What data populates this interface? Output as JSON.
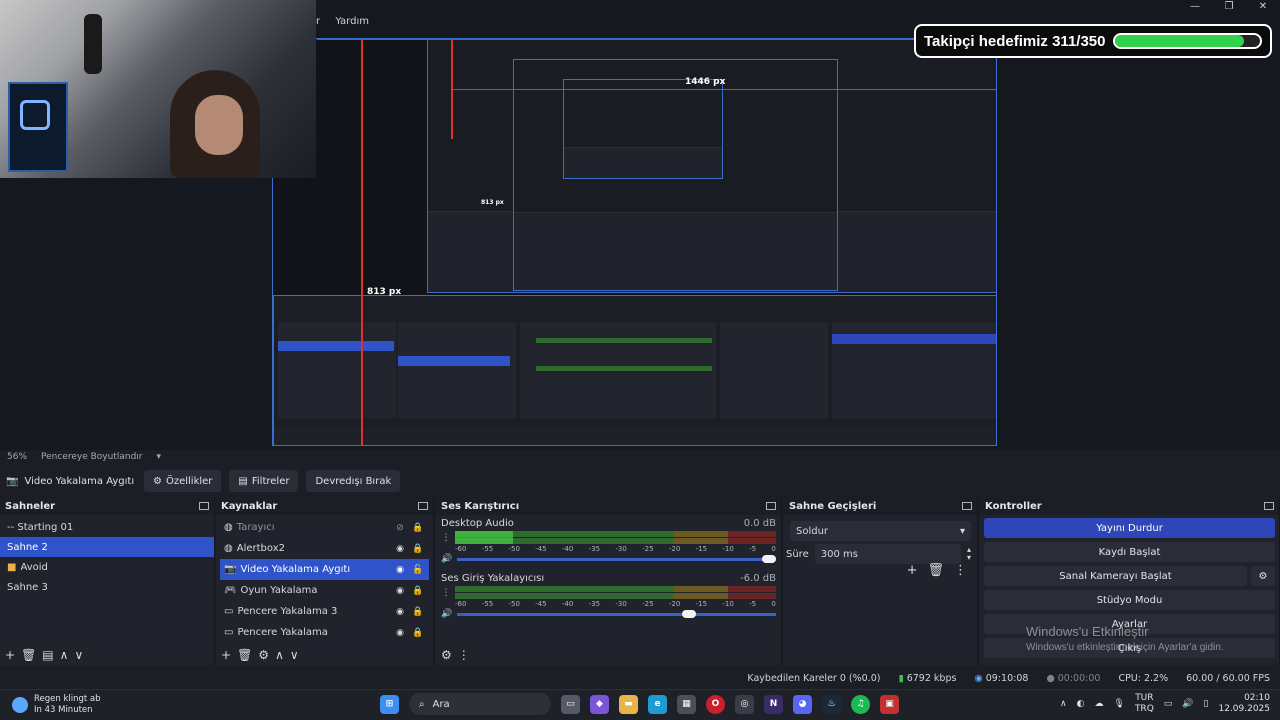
{
  "window": {
    "minimize": "—",
    "maximize": "❐",
    "close": "✕"
  },
  "menubar": {
    "item1": "r",
    "item2": "Yardım"
  },
  "overlay": {
    "follower_goal": "Takipçi hedefimiz 311/350",
    "current": 311,
    "target": 350,
    "fill_color": "#2fd24a"
  },
  "preview": {
    "px_label_1": "1446 px",
    "px_label_2": "813 px",
    "px_label_3": "813 px",
    "zoom": "56%",
    "resize_mode": "Pencereye Boyutlandır"
  },
  "source_toolbar": {
    "selected_source": "Video Yakalama Aygıtı",
    "properties": "Özellikler",
    "filters": "Filtreler",
    "deactivate": "Devredışı Bırak"
  },
  "scenes": {
    "title": "Sahneler",
    "items": [
      {
        "label": "-- Starting 01",
        "selected": false,
        "icon": ""
      },
      {
        "label": "Sahne 2",
        "selected": true,
        "icon": ""
      },
      {
        "label": "Avoid",
        "selected": false,
        "icon": "folder-icon"
      },
      {
        "label": "Sahne 3",
        "selected": false,
        "icon": ""
      }
    ],
    "footer": [
      "+",
      "🗑",
      "▤",
      "∧",
      "∨"
    ]
  },
  "sources": {
    "title": "Kaynaklar",
    "items": [
      {
        "label": "Tarayıcı",
        "icon": "globe-icon",
        "visible": false,
        "locked": true,
        "selected": false
      },
      {
        "label": "Alertbox2",
        "icon": "globe-icon",
        "visible": true,
        "locked": true,
        "selected": false
      },
      {
        "label": "Video Yakalama Aygıtı",
        "icon": "camera-icon",
        "visible": true,
        "locked": false,
        "selected": true
      },
      {
        "label": "Oyun Yakalama",
        "icon": "gamepad-icon",
        "visible": true,
        "locked": true,
        "selected": false
      },
      {
        "label": "Pencere Yakalama 3",
        "icon": "window-icon",
        "visible": true,
        "locked": true,
        "selected": false
      },
      {
        "label": "Pencere Yakalama",
        "icon": "window-icon",
        "visible": true,
        "locked": true,
        "selected": false
      }
    ]
  },
  "mixer": {
    "title": "Ses Karıştırıcı",
    "ticks": [
      "-60",
      "-55",
      "-50",
      "-45",
      "-40",
      "-35",
      "-30",
      "-25",
      "-20",
      "-15",
      "-10",
      "-5",
      "0"
    ],
    "channels": [
      {
        "name": "Desktop Audio",
        "db": "0.0 dB",
        "level": 0.18,
        "volume": 1.0
      },
      {
        "name": "Ses Giriş Yakalayıcısı",
        "db": "-6.0 dB",
        "level": 0.0,
        "volume": 0.75
      }
    ]
  },
  "transitions": {
    "title": "Sahne Geçişleri",
    "selected": "Soldur",
    "duration_label": "Süre",
    "duration": "300 ms"
  },
  "controls": {
    "title": "Kontroller",
    "stop_stream": "Yayını Durdur",
    "start_record": "Kaydı Başlat",
    "virtual_cam": "Sanal Kamerayı Başlat",
    "studio_mode": "Stüdyo Modu",
    "settings": "Ayarlar",
    "exit": "Çıkış"
  },
  "activation": {
    "title": "Windows'u Etkinleştir",
    "subtitle": "Windows'u etkinleştirmek için Ayarlar'a gidin."
  },
  "status": {
    "dropped": "Kaybedilen Kareler 0 (%0.0)",
    "bitrate": "6792 kbps",
    "stream_time": "09:10:08",
    "record_time": "00:00:00",
    "cpu": "CPU: 2.2%",
    "fps": "60.00 / 60.00 FPS"
  },
  "taskbar": {
    "weather_title": "Regen klingt ab",
    "weather_sub": "In 43 Minuten",
    "search_placeholder": "Ara",
    "lang_top": "TUR",
    "lang_bottom": "TRQ",
    "time": "02:10",
    "date": "12.09.2025"
  }
}
